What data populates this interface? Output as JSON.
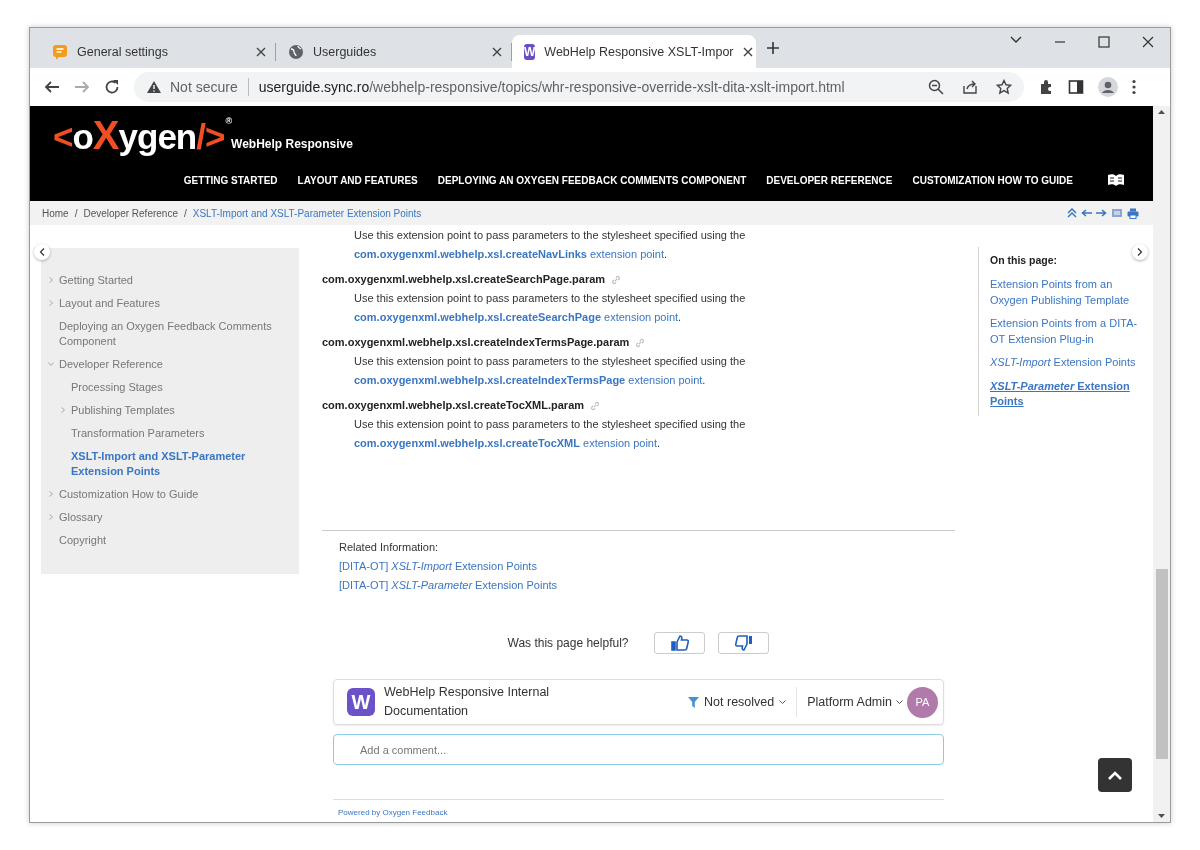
{
  "browser": {
    "tabs": [
      {
        "title": "General settings",
        "kind": "feedback",
        "selected": false
      },
      {
        "title": "Userguides",
        "kind": "globe",
        "selected": false
      },
      {
        "title": "WebHelp Responsive XSLT-Impor",
        "kind": "webhelp",
        "icon_text": "W",
        "selected": true
      }
    ],
    "address_bar": {
      "security": "Not secure",
      "host": "userguide.sync.ro",
      "path": "/webhelp-responsive/topics/whr-responsive-override-xslt-dita-xslt-import.html"
    }
  },
  "header": {
    "logo": [
      {
        "text": "<",
        "accent": true
      },
      {
        "text": "o",
        "accent": false
      },
      {
        "text": "X",
        "accent": true
      },
      {
        "text": "ygen",
        "accent": false
      },
      {
        "text": "/>",
        "accent": true
      }
    ],
    "logo_mark": "®",
    "product": "WebHelp Responsive",
    "nav": [
      "GETTING STARTED",
      "LAYOUT AND FEATURES",
      "DEPLOYING AN OXYGEN FEEDBACK COMMENTS COMPONENT",
      "DEVELOPER REFERENCE",
      "CUSTOMIZATION HOW TO GUIDE"
    ]
  },
  "breadcrumb": {
    "separator": "/",
    "items": [
      {
        "label": "Home",
        "selected": false
      },
      {
        "label": "Developer Reference",
        "selected": false
      },
      {
        "label": "XSLT-Import and XSLT-Parameter Extension Points",
        "selected": true
      }
    ]
  },
  "sidebar": {
    "items": [
      {
        "label": "Getting Started",
        "expanded": false,
        "selected": false
      },
      {
        "label": "Layout and Features",
        "expanded": false,
        "selected": false
      },
      {
        "label": "Deploying an Oxygen Feedback Comments Component",
        "selected": false
      },
      {
        "label": "Developer Reference",
        "expanded": true,
        "selected": false,
        "children": [
          {
            "label": "Processing Stages",
            "selected": false
          },
          {
            "label": "Publishing Templates",
            "expanded": false,
            "selected": false
          },
          {
            "label": "Transformation Parameters",
            "selected": false
          },
          {
            "label": "XSLT-Import and XSLT-Parameter Extension Points",
            "selected": true
          }
        ]
      },
      {
        "label": "Customization How to Guide",
        "expanded": false,
        "selected": false
      },
      {
        "label": "Glossary",
        "expanded": false,
        "selected": false
      },
      {
        "label": "Copyright",
        "selected": false
      }
    ]
  },
  "content": {
    "entries": [
      {
        "description": "Use this extension point to pass parameters to the stylesheet specified using the",
        "link": "**com.oxygenxml.webhelp.xsl.createNavLinks** extension point",
        "after": "."
      },
      {
        "term": "com.oxygenxml.webhelp.xsl.createSearchPage.param",
        "description": "Use this extension point to pass parameters to the stylesheet specified using the",
        "link": "**com.oxygenxml.webhelp.xsl.createSearchPage** extension point",
        "after": "."
      },
      {
        "term": "com.oxygenxml.webhelp.xsl.createIndexTermsPage.param",
        "description": "Use this extension point to pass parameters to the stylesheet specified using the",
        "link": "**com.oxygenxml.webhelp.xsl.createIndexTermsPage** extension point",
        "after": "."
      },
      {
        "term": "com.oxygenxml.webhelp.xsl.createTocXML.param",
        "description": "Use this extension point to pass parameters to the stylesheet specified using the",
        "link": "**com.oxygenxml.webhelp.xsl.createTocXML** extension point",
        "after": "."
      }
    ],
    "related": {
      "title": "Related Information:",
      "links": [
        "[DITA-OT] *XSLT-Import* Extension Points",
        "[DITA-OT] *XSLT-Parameter* Extension Points"
      ]
    },
    "helpful_question": "Was this page helpful?"
  },
  "comments": {
    "logo_text": "W",
    "product": "WebHelp Responsive Internal Documentation",
    "filter": "Not resolved",
    "user": "Platform Admin",
    "avatar": "PA",
    "placeholder": "Add a comment...",
    "powered_by": "Powered by Oxygen Feedback"
  },
  "page_toc": {
    "title": "On this page:",
    "items": [
      {
        "label": "Extension Points from an Oxygen Publishing Template",
        "selected": false
      },
      {
        "label": "Extension Points from a DITA-OT Extension Plug-in",
        "selected": false
      },
      {
        "label": "*XSLT-Import* Extension Points",
        "selected": false
      },
      {
        "label": "*XSLT-Parameter* Extension Points",
        "selected": true
      }
    ]
  }
}
